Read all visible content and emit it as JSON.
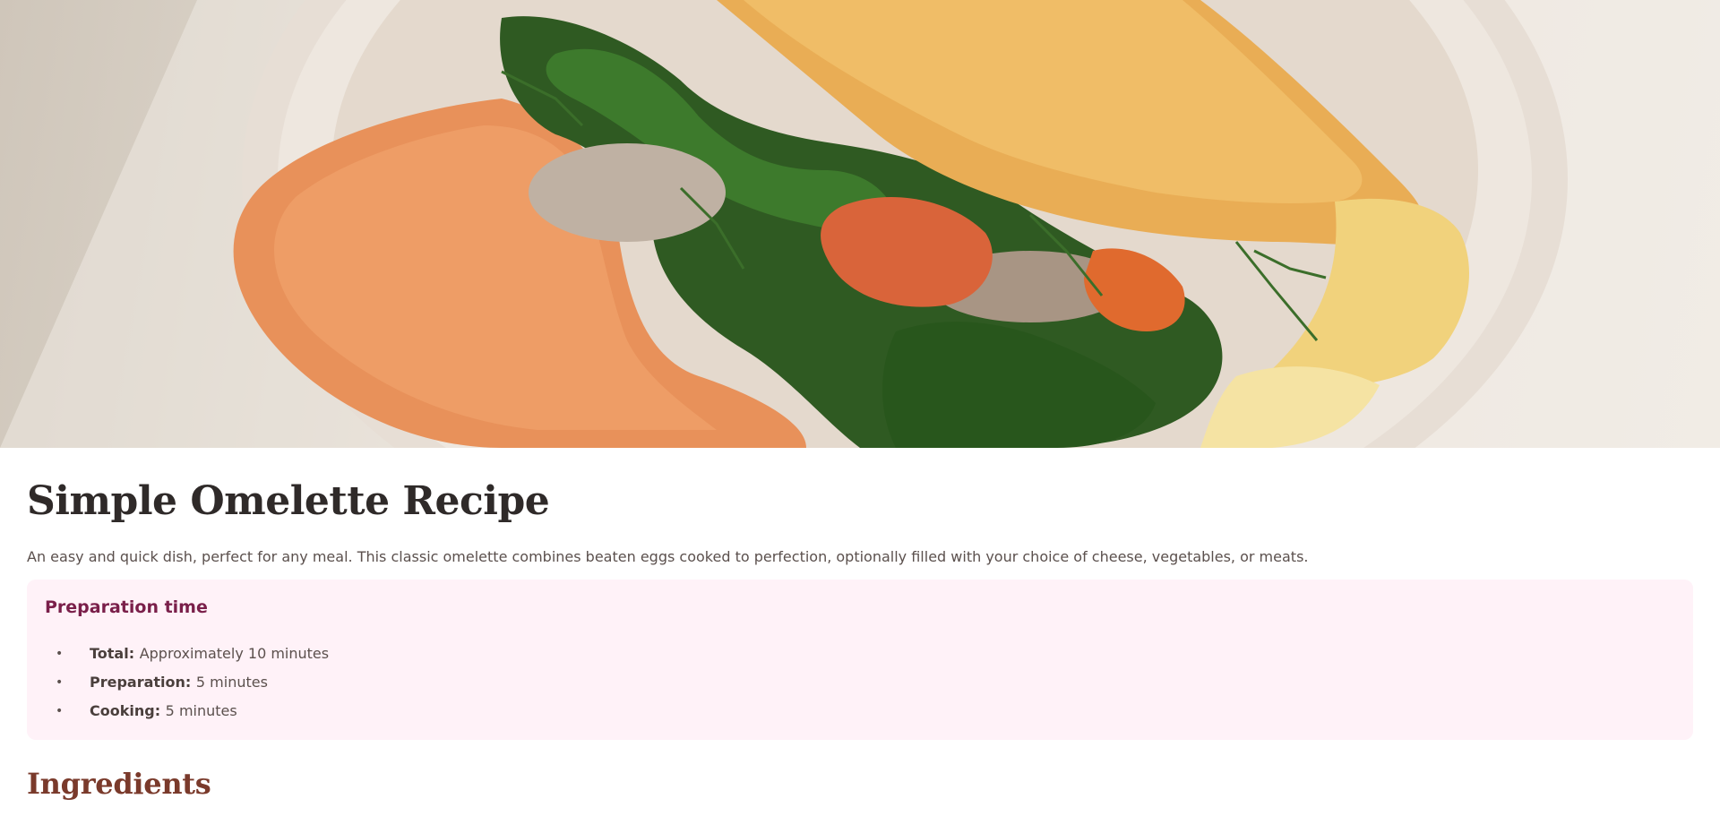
{
  "hero": {
    "image_alt": "Omelette with spinach, dill, mushrooms and spread on a plate"
  },
  "recipe": {
    "title": "Simple Omelette Recipe",
    "intro": "An easy and quick dish, perfect for any meal. This classic omelette combines beaten eggs cooked to perfection, optionally filled with your choice of cheese, vegetables, or meats."
  },
  "preparation": {
    "heading": "Preparation time",
    "items": [
      {
        "label": "Total:",
        "value": "Approximately 10 minutes"
      },
      {
        "label": "Preparation:",
        "value": "5 minutes"
      },
      {
        "label": "Cooking:",
        "value": "5 minutes"
      }
    ]
  },
  "ingredients": {
    "heading": "Ingredients"
  },
  "colors": {
    "title": "#2f2a29",
    "prep_box_bg": "#fff2f8",
    "prep_heading": "#7a1f4a",
    "ingredients_heading": "#7a3a2b",
    "body_text": "#5b504d"
  }
}
